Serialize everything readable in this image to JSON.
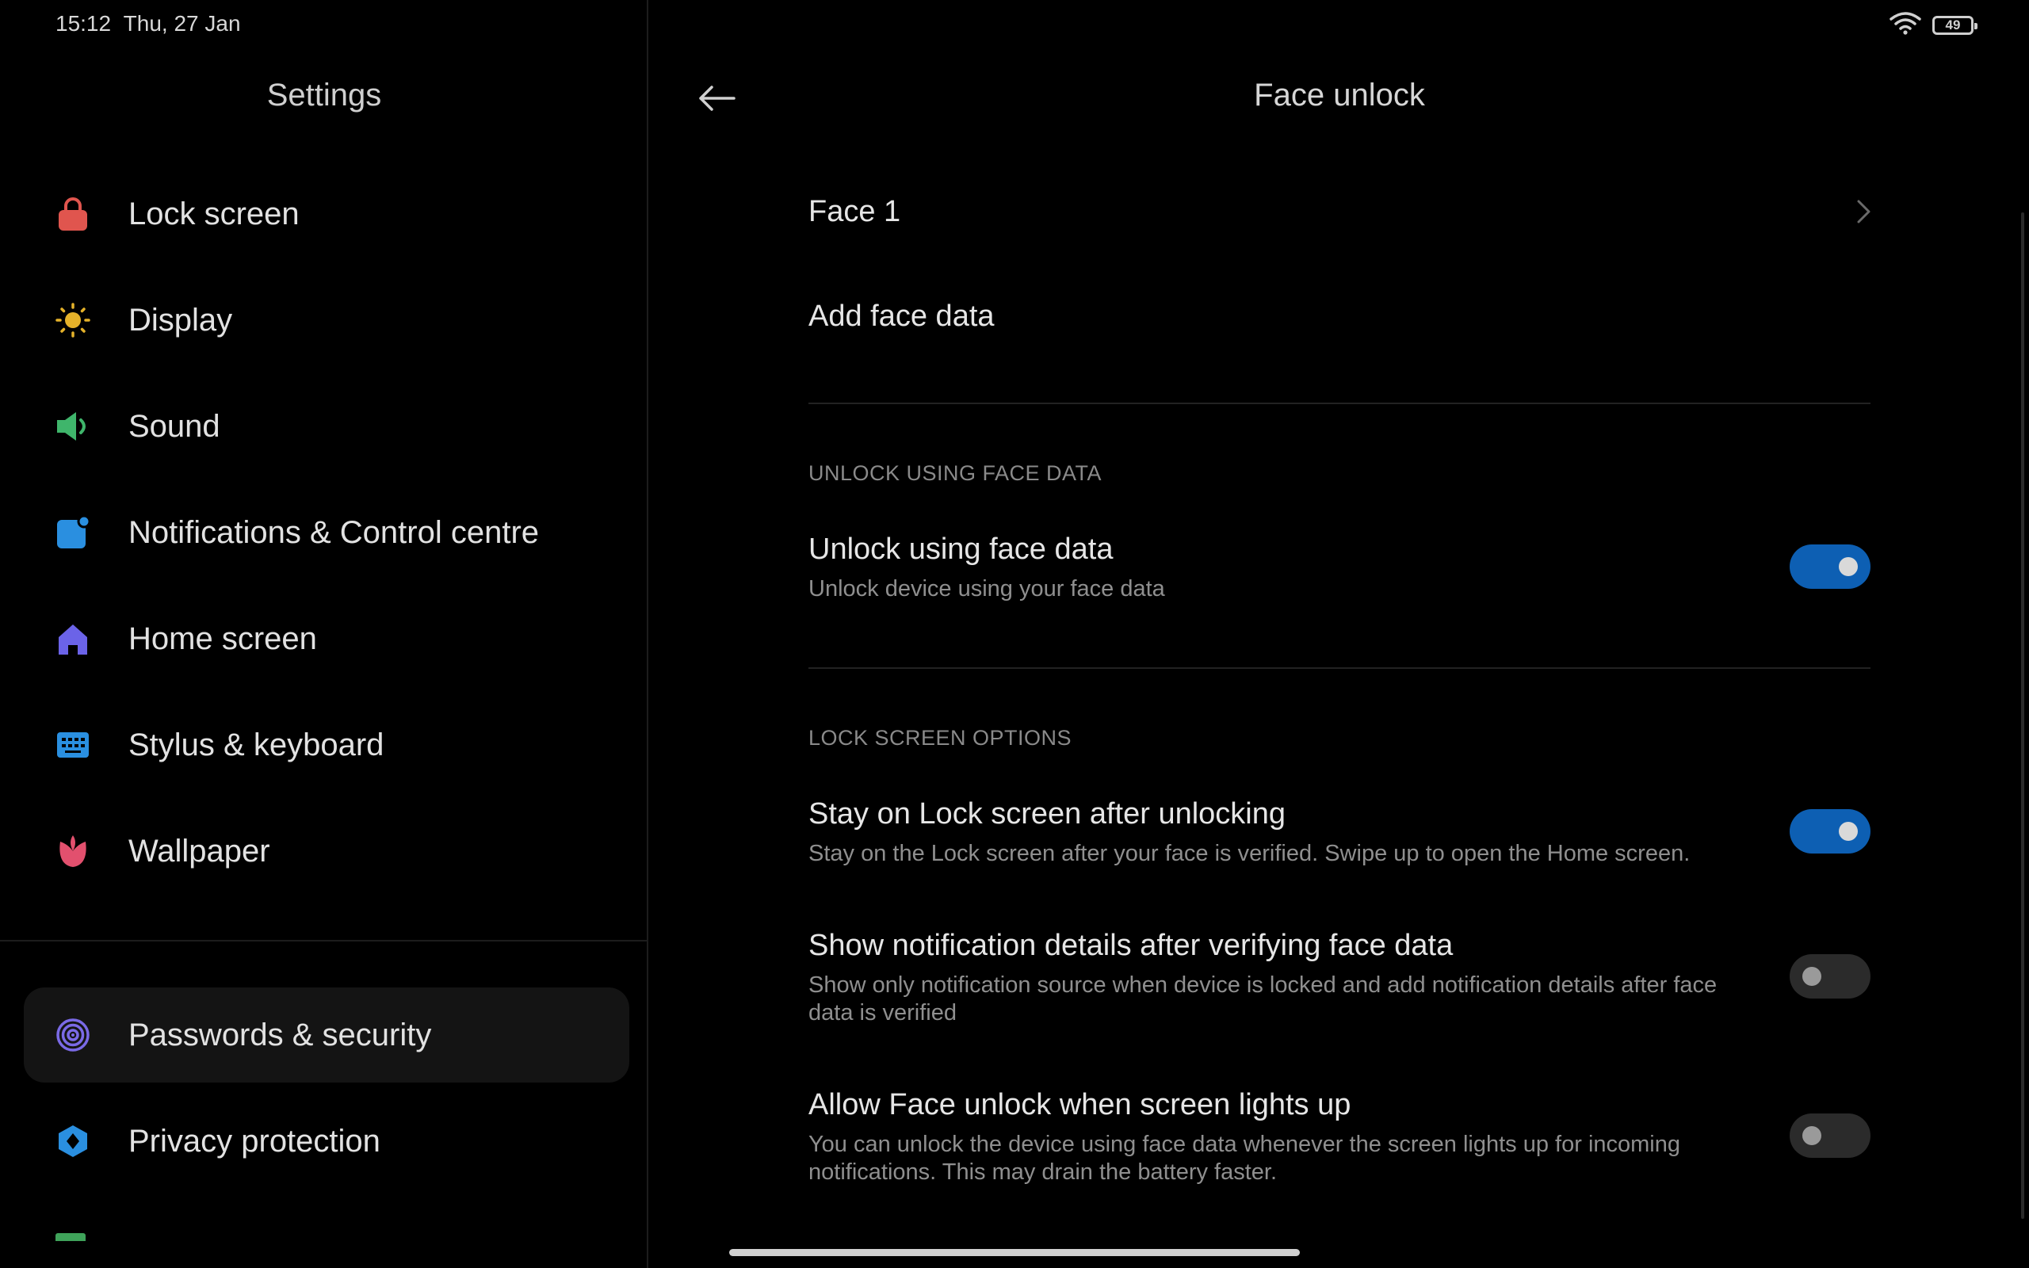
{
  "status_bar": {
    "time": "15:12",
    "date": "Thu, 27 Jan",
    "battery": "49",
    "icons": [
      "wifi-icon",
      "battery-icon"
    ]
  },
  "sidebar": {
    "title": "Settings",
    "items": [
      {
        "label": "Lock screen",
        "icon": "lock-icon",
        "color": "#e0554e"
      },
      {
        "label": "Display",
        "icon": "sun-icon",
        "color": "#e5b22a"
      },
      {
        "label": "Sound",
        "icon": "speaker-icon",
        "color": "#3fb56b"
      },
      {
        "label": "Notifications & Control centre",
        "icon": "notification-icon",
        "color": "#2a8fe0"
      },
      {
        "label": "Home screen",
        "icon": "home-icon",
        "color": "#6b63e8"
      },
      {
        "label": "Stylus & keyboard",
        "icon": "keyboard-icon",
        "color": "#2a8fe0"
      },
      {
        "label": "Wallpaper",
        "icon": "flower-icon",
        "color": "#e2506e"
      },
      {
        "label": "Passwords & security",
        "icon": "fingerprint-icon",
        "color": "#7a6ae6",
        "selected": true
      },
      {
        "label": "Privacy protection",
        "icon": "shield-icon",
        "color": "#2a8fe0"
      }
    ]
  },
  "page": {
    "title": "Face unlock",
    "face_item": "Face 1",
    "add_face": "Add face data",
    "section_unlock": "UNLOCK USING FACE DATA",
    "unlock_title": "Unlock using face data",
    "unlock_sub": "Unlock device using your face data",
    "unlock_on": true,
    "section_lock": "LOCK SCREEN OPTIONS",
    "stay_title": "Stay on Lock screen after unlocking",
    "stay_sub": "Stay on the Lock screen after your face is verified. Swipe up to open the Home screen.",
    "stay_on": true,
    "notif_title": "Show notification details after verifying face data",
    "notif_sub": "Show only notification source when device is locked and add notification details after face data is verified",
    "notif_on": false,
    "lightsup_title": "Allow Face unlock when screen lights up",
    "lightsup_sub": "You can unlock the device using face data whenever the screen lights up for incoming notifications. This may drain the battery faster.",
    "lightsup_on": false
  },
  "colors": {
    "toggle_on": "#0d5fb3",
    "toggle_off": "#2b2b2b",
    "background": "#000000"
  }
}
